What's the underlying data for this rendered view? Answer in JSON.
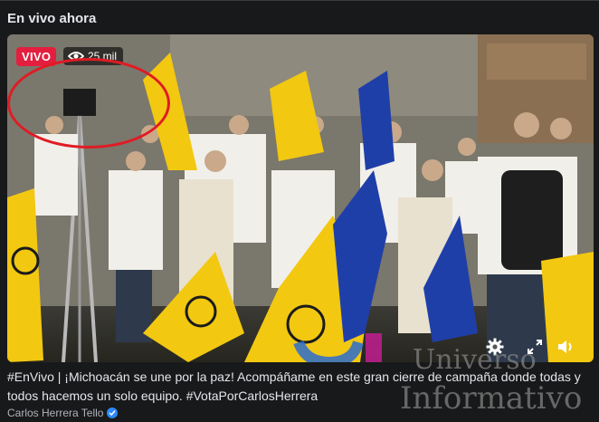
{
  "section": {
    "title": "En vivo ahora"
  },
  "video": {
    "live_label": "VIVO",
    "viewers": "25 mil",
    "controls": {
      "settings_icon": "gear-icon",
      "fullscreen_icon": "expand-icon",
      "volume_icon": "speaker-icon"
    }
  },
  "post": {
    "caption": "#EnVivo | ¡Michoacán se une por la paz! Acompáñame en este gran cierre de campaña donde todas y todos hacemos un solo equipo. #VotaPorCarlosHerrera",
    "author": "Carlos Herrera Tello",
    "verified": true
  },
  "watermark": {
    "line1": "Universo",
    "line2": "Informativo"
  },
  "colors": {
    "live_red": "#e41e3f",
    "ring_red": "#e01b24",
    "prd_yellow": "#f2c811",
    "pan_blue": "#1f3fa8"
  }
}
